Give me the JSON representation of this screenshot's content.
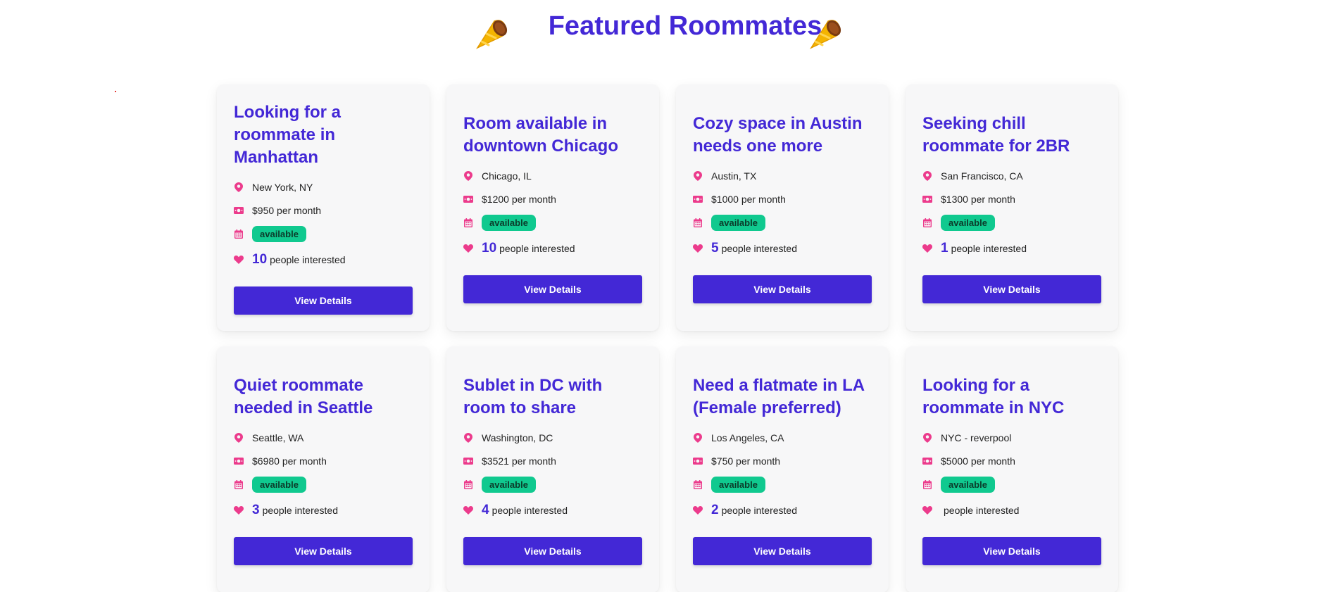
{
  "header": {
    "title": "Featured Roommates",
    "left_icon": "party-horn-icon",
    "right_icon": "party-horn-icon"
  },
  "icons": {
    "location": "map-pin-icon",
    "price": "money-bill-icon",
    "availability": "calendar-icon",
    "interest": "heart-icon"
  },
  "colors": {
    "accent": "#4328d6",
    "icon_pink": "#ec3b8c",
    "badge_green": "#10c98f",
    "card_bg": "#f7f7f8"
  },
  "listings": [
    {
      "title": "Looking for a roommate in Manhattan",
      "location": "New York, NY",
      "price": "$950 per month",
      "status": "available",
      "interested_count": "10",
      "interested_label": "people interested",
      "button_label": "View Details"
    },
    {
      "title": "Room available in downtown Chicago",
      "location": "Chicago, IL",
      "price": "$1200 per month",
      "status": "available",
      "interested_count": "10",
      "interested_label": "people interested",
      "button_label": "View Details"
    },
    {
      "title": "Cozy space in Austin needs one more",
      "location": "Austin, TX",
      "price": "$1000 per month",
      "status": "available",
      "interested_count": "5",
      "interested_label": "people interested",
      "button_label": "View Details"
    },
    {
      "title": "Seeking chill roommate for 2BR",
      "location": "San Francisco, CA",
      "price": "$1300 per month",
      "status": "available",
      "interested_count": "1",
      "interested_label": "people interested",
      "button_label": "View Details"
    },
    {
      "title": "Quiet roommate needed in Seattle",
      "location": "Seattle, WA",
      "price": "$6980 per month",
      "status": "available",
      "interested_count": "3",
      "interested_label": "people interested",
      "button_label": "View Details"
    },
    {
      "title": "Sublet in DC with room to share",
      "location": "Washington, DC",
      "price": "$3521 per month",
      "status": "available",
      "interested_count": "4",
      "interested_label": "people interested",
      "button_label": "View Details"
    },
    {
      "title": "Need a flatmate in LA (Female preferred)",
      "location": "Los Angeles, CA",
      "price": "$750 per month",
      "status": "available",
      "interested_count": "2",
      "interested_label": "people interested",
      "button_label": "View Details"
    },
    {
      "title": "Looking for a roommate in NYC",
      "location": "NYC - reverpool",
      "price": "$5000 per month",
      "status": "available",
      "interested_count": "",
      "interested_label": "people interested",
      "button_label": "View Details"
    }
  ]
}
